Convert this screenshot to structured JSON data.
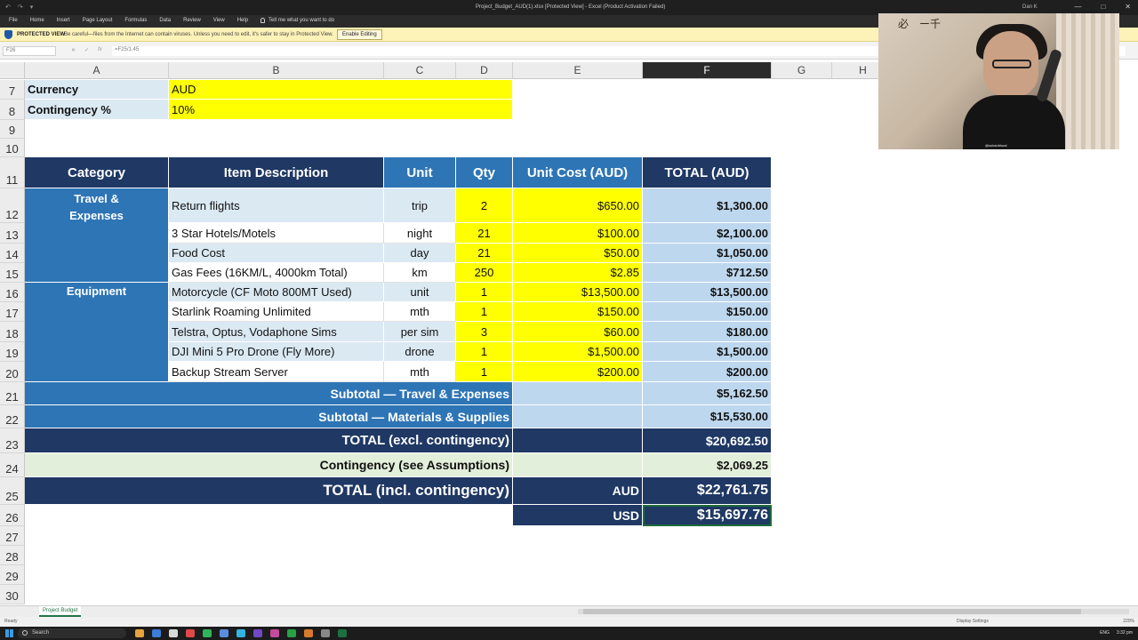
{
  "window": {
    "title": "Project_Budget_AUD(1).xlsx [Protected View] - Excel (Product Activation Failed)",
    "user": "Dan K",
    "quick_access": [
      "↶",
      "↷",
      "▾"
    ]
  },
  "menu": [
    "File",
    "Home",
    "Insert",
    "Page Layout",
    "Formulas",
    "Data",
    "Review",
    "View",
    "Help"
  ],
  "tell_me": "Tell me what you want to do",
  "protected_view": {
    "label": "PROTECTED VIEW",
    "message": "Be careful—files from the Internet can contain viruses. Unless you need to edit, it's safer to stay in Protected View.",
    "button": "Enable Editing"
  },
  "formula_bar": {
    "name_box": "F26",
    "formula": "=F25/1.45"
  },
  "columns": [
    "A",
    "B",
    "C",
    "D",
    "E",
    "F",
    "G",
    "H"
  ],
  "rows": [
    "7",
    "8",
    "9",
    "10",
    "11",
    "12",
    "13",
    "14",
    "15",
    "16",
    "17",
    "18",
    "19",
    "20",
    "21",
    "22",
    "23",
    "24",
    "25",
    "26",
    "27",
    "28",
    "29",
    "30"
  ],
  "settings": {
    "currency_label": "Currency",
    "currency_value": "AUD",
    "contingency_label": "Contingency %",
    "contingency_value": "10%"
  },
  "table_headers": {
    "category": "Category",
    "item": "Item Description",
    "unit": "Unit",
    "qty": "Qty",
    "unit_cost": "Unit Cost (AUD)",
    "total": "TOTAL (AUD)"
  },
  "categories": {
    "travel": "Travel & Expenses",
    "equipment": "Equipment"
  },
  "items": [
    {
      "desc": "Return flights",
      "unit": "trip",
      "qty": "2",
      "cost": "$650.00",
      "total": "$1,300.00"
    },
    {
      "desc": "3 Star Hotels/Motels",
      "unit": "night",
      "qty": "21",
      "cost": "$100.00",
      "total": "$2,100.00"
    },
    {
      "desc": "Food Cost",
      "unit": "day",
      "qty": "21",
      "cost": "$50.00",
      "total": "$1,050.00"
    },
    {
      "desc": "Gas Fees (16KM/L, 4000km Total)",
      "unit": "km",
      "qty": "250",
      "cost": "$2.85",
      "total": "$712.50"
    },
    {
      "desc": "Motorcycle (CF Moto 800MT Used)",
      "unit": "unit",
      "qty": "1",
      "cost": "$13,500.00",
      "total": "$13,500.00"
    },
    {
      "desc": "Starlink Roaming Unlimited",
      "unit": "mth",
      "qty": "1",
      "cost": "$150.00",
      "total": "$150.00"
    },
    {
      "desc": "Telstra, Optus, Vodaphone Sims",
      "unit": "per sim",
      "qty": "3",
      "cost": "$60.00",
      "total": "$180.00"
    },
    {
      "desc": "DJI Mini 5 Pro Drone (Fly More)",
      "unit": "drone",
      "qty": "1",
      "cost": "$1,500.00",
      "total": "$1,500.00"
    },
    {
      "desc": "Backup Stream Server",
      "unit": "mth",
      "qty": "1",
      "cost": "$200.00",
      "total": "$200.00"
    }
  ],
  "summary": {
    "subtotal_travel_label": "Subtotal — Travel & Expenses",
    "subtotal_travel_value": "$5,162.50",
    "subtotal_materials_label": "Subtotal — Materials & Supplies",
    "subtotal_materials_value": "$15,530.00",
    "total_excl_label": "TOTAL (excl. contingency)",
    "total_excl_value": "$20,692.50",
    "contingency_label": "Contingency (see Assumptions)",
    "contingency_value": "$2,069.25",
    "total_incl_label": "TOTAL (incl. contingency)",
    "aud_label": "AUD",
    "aud_value": "$22,761.75",
    "usd_label": "USD",
    "usd_value": "$15,697.76"
  },
  "sheet_tab": "Project Budget",
  "status": {
    "ready": "Ready",
    "display": "Display Settings",
    "zoom": "220%"
  },
  "taskbar": {
    "search": "Search",
    "lang": "ENG",
    "time": "3:32 pm"
  },
  "webcam": {
    "logo": "必　ー千",
    "handle": "@sukanblood"
  },
  "colors": {
    "header_dark": "#1f3864",
    "header_blue": "#2e75b6",
    "light_blue": "#dbe9f3",
    "total_blue": "#bdd7ee",
    "yellow": "#ffff00",
    "green": "#e2efda"
  }
}
